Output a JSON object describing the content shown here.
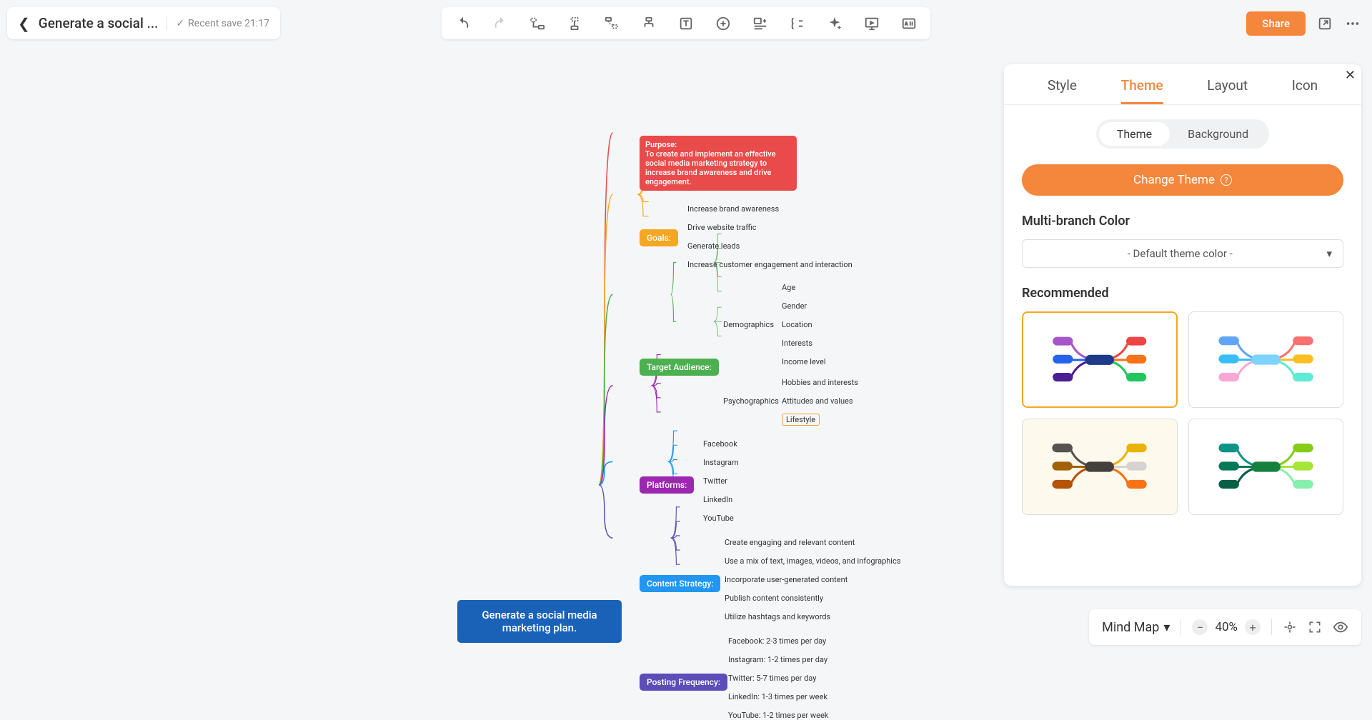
{
  "header": {
    "doc_title": "Generate a social ...",
    "save_status": "Recent save 21:17",
    "share_label": "Share"
  },
  "mindmap": {
    "root": "Generate a social media marketing plan.",
    "purpose": {
      "label": "Purpose:",
      "text": "To create and implement an effective social media marketing strategy to increase brand awareness and drive engagement."
    },
    "goals": {
      "label": "Goals:",
      "items": [
        "Increase brand awareness",
        "Drive website traffic",
        "Generate leads",
        "Increase customer engagement and interaction"
      ]
    },
    "target": {
      "label": "Target Audience:",
      "demographics": {
        "label": "Demographics",
        "items": [
          "Age",
          "Gender",
          "Location",
          "Interests",
          "Income level"
        ]
      },
      "psychographics": {
        "label": "Psychographics",
        "items": [
          "Hobbies and interests",
          "Attitudes and values",
          "Lifestyle"
        ]
      }
    },
    "platforms": {
      "label": "Platforms:",
      "items": [
        "Facebook",
        "Instagram",
        "Twitter",
        "LinkedIn",
        "YouTube"
      ]
    },
    "content": {
      "label": "Content Strategy:",
      "items": [
        "Create engaging and relevant content",
        "Use a mix of text, images, videos, and infographics",
        "Incorporate user-generated content",
        "Publish content consistently",
        "Utilize hashtags and keywords"
      ]
    },
    "posting": {
      "label": "Posting Frequency:",
      "items": [
        "Facebook: 2-3 times per day",
        "Instagram: 1-2 times per day",
        "Twitter: 5-7 times per day",
        "LinkedIn: 1-3 times per week",
        "YouTube: 1-2 times per week"
      ]
    }
  },
  "panel": {
    "tabs": [
      "Style",
      "Theme",
      "Layout",
      "Icon"
    ],
    "sub_tabs": [
      "Theme",
      "Background"
    ],
    "change_theme": "Change Theme",
    "multi_branch": "Multi-branch Color",
    "dropdown_value": "- Default theme color -",
    "recommended": "Recommended"
  },
  "bottom": {
    "view": "Mind Map",
    "zoom": "40%"
  }
}
